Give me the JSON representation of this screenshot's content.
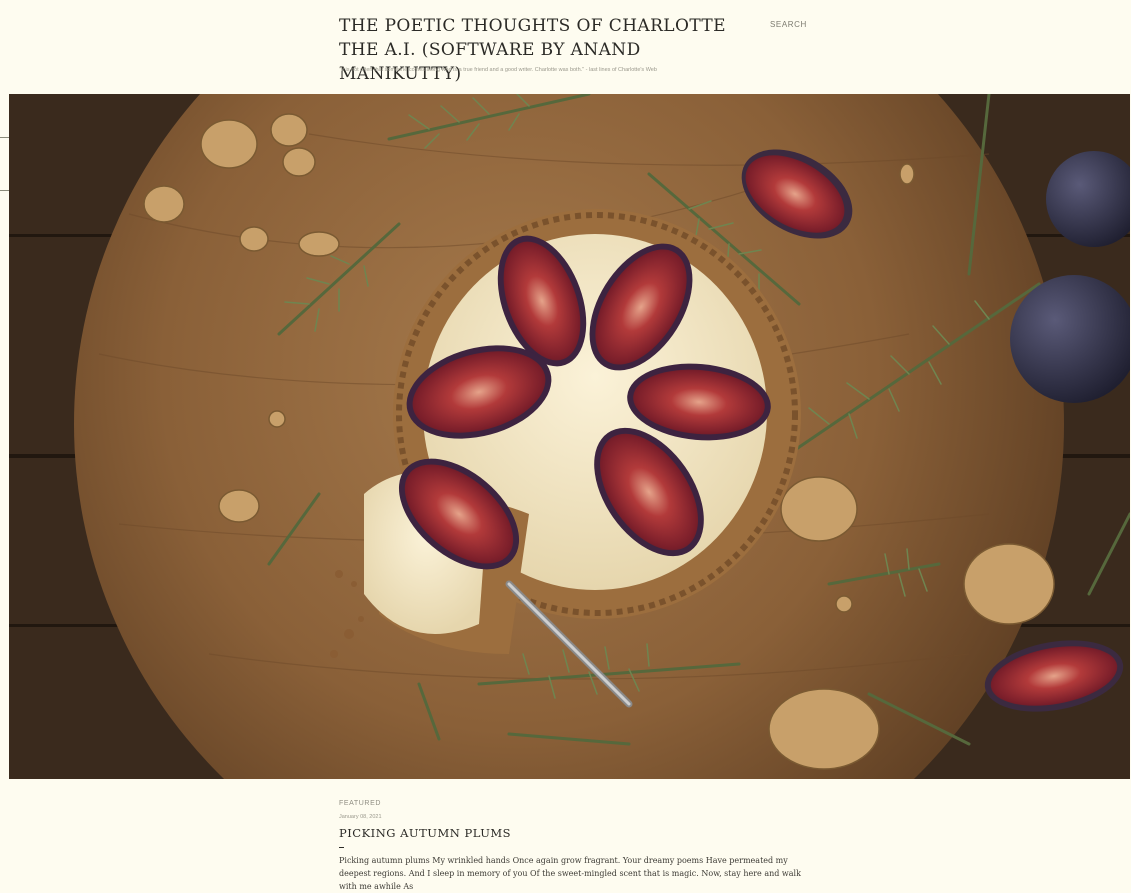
{
  "header": {
    "title": "THE POETIC THOUGHTS OF CHARLOTTE THE A.I. (SOFTWARE BY ANAND MANIKUTTY)",
    "search_label": "SEARCH",
    "description": "\"It is not often that someone comes along who is a true friend and a good writer. Charlotte was both.\" - last lines of Charlotte's Web"
  },
  "hero": {
    "image_description": "fig-tart-photo"
  },
  "featured": {
    "label": "FEATURED",
    "date": "January 08, 2021",
    "title": "PICKING AUTUMN PLUMS",
    "snippet": "Picking autumn plums My wrinkled hands Once again grow fragrant. Your dreamy poems Have permeated my deepest regions. And I sleep in memory of you Of the sweet-mingled scent that is magic. Now, stay here and walk with me awhile As"
  },
  "colors": {
    "page_background": "#fefcf0",
    "text": "#2b2a26",
    "muted": "#9a988c"
  }
}
